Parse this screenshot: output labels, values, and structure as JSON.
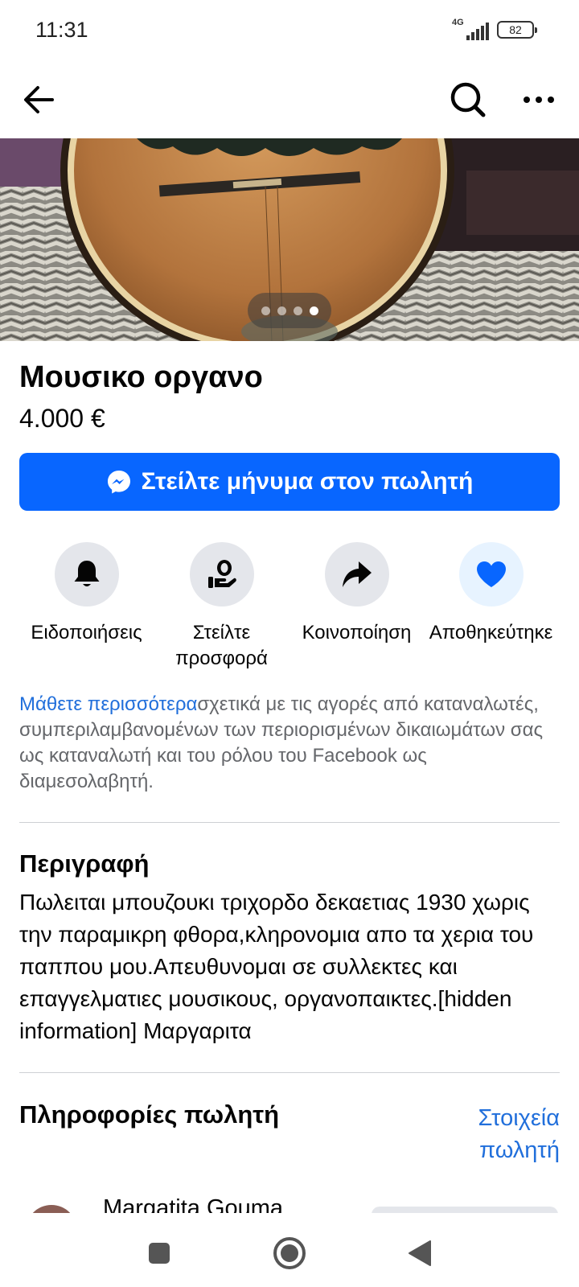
{
  "status_bar": {
    "time": "11:31",
    "network": "4G",
    "battery": "82"
  },
  "nav": {
    "back_icon": "arrow-left-icon",
    "search_icon": "search-icon",
    "more_icon": "more-dots-icon"
  },
  "carousel": {
    "total": 4,
    "active_index": 3
  },
  "listing": {
    "title": "Μουσικο οργανο",
    "price": "4.000 €"
  },
  "message_button": {
    "label": "Στείλτε μήνυμα στον πωλητή",
    "icon": "messenger-icon",
    "color": "#0866ff"
  },
  "actions": [
    {
      "label": "Ειδοποιήσεις",
      "icon": "bell-icon"
    },
    {
      "label": "Στείλτε προσφορά",
      "icon": "offer-icon"
    },
    {
      "label": "Κοινοποίηση",
      "icon": "share-icon"
    },
    {
      "label": "Αποθηκεύτηκε",
      "icon": "heart-icon"
    }
  ],
  "info": {
    "link": "Μάθετε περισσότερα",
    "text": "σχετικά με τις αγορές από καταναλωτές, συμπεριλαμβανομένων των περιορισμένων δικαιωμάτων σας ως καταναλωτή και του ρόλου του Facebook ως διαμεσολαβητή."
  },
  "description": {
    "title": "Περιγραφή",
    "body": "Πωλειται μπουζουκι τριχορδο δεκαετιας 1930 χωρις την παραμικρη φθορα,κληρονομια απο τα χερια του  παππου μου.Απευθυνομαι σε συλλεκτες και επαγγελματιες μουσικους, οργανοπαικτες.[hidden information] Μαργαριτα"
  },
  "seller": {
    "title": "Πληροφορίες πωλητή",
    "link": "Στοιχεία πωλητή",
    "name": "Margatita Gouma"
  },
  "system_nav": {
    "recents_icon": "square-icon",
    "home_icon": "circle-icon",
    "back_icon": "triangle-back-icon"
  },
  "colors": {
    "link": "#216fdb",
    "muted_text": "#65676b",
    "icon_bg": "#e4e6eb",
    "saved_bg": "#e7f3ff",
    "saved_heart": "#0866ff"
  }
}
